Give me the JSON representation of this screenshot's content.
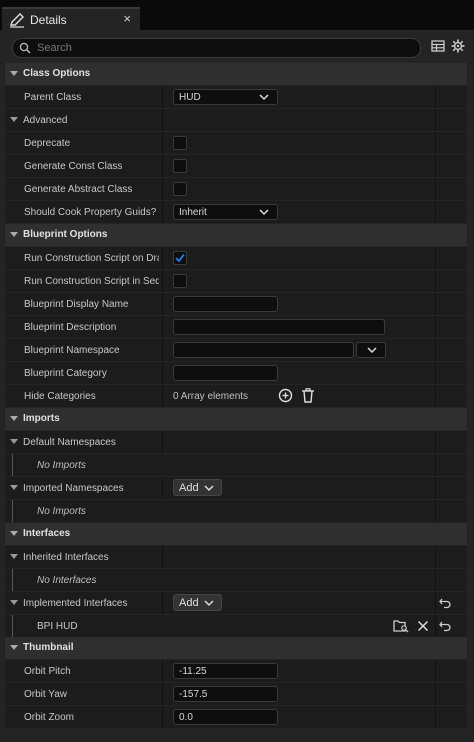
{
  "tab": {
    "title": "Details",
    "close": "×"
  },
  "search": {
    "placeholder": "Search"
  },
  "categories": {
    "class_options": "Class Options",
    "advanced": "Advanced",
    "blueprint_options": "Blueprint Options",
    "imports": "Imports",
    "interfaces": "Interfaces",
    "thumbnail": "Thumbnail"
  },
  "props": {
    "parent_class": {
      "label": "Parent Class",
      "value": "HUD"
    },
    "deprecate": {
      "label": "Deprecate",
      "checked": false
    },
    "gen_const": {
      "label": "Generate Const Class",
      "checked": false
    },
    "gen_abstract": {
      "label": "Generate Abstract Class",
      "checked": false
    },
    "cook_guids": {
      "label": "Should Cook Property Guids?",
      "value": "Inherit"
    },
    "run_cs_drag": {
      "label": "Run Construction Script on Drag",
      "checked": true
    },
    "run_cs_seq": {
      "label": "Run Construction Script in Sequ...",
      "checked": false
    },
    "bp_display_name": {
      "label": "Blueprint Display Name",
      "value": ""
    },
    "bp_description": {
      "label": "Blueprint Description",
      "value": ""
    },
    "bp_namespace": {
      "label": "Blueprint Namespace",
      "value": ""
    },
    "bp_category": {
      "label": "Blueprint Category",
      "value": ""
    },
    "hide_categories": {
      "label": "Hide Categories",
      "value": "0 Array elements"
    },
    "default_namespaces": {
      "label": "Default Namespaces",
      "empty": "No Imports"
    },
    "imported_namespaces": {
      "label": "Imported Namespaces",
      "add": "Add",
      "empty": "No Imports"
    },
    "inherited_interfaces": {
      "label": "Inherited Interfaces",
      "empty": "No Interfaces"
    },
    "implemented_interfaces": {
      "label": "Implemented Interfaces",
      "add": "Add",
      "item": "BPI HUD"
    },
    "orbit_pitch": {
      "label": "Orbit Pitch",
      "value": "-11.25"
    },
    "orbit_yaw": {
      "label": "Orbit Yaw",
      "value": "-157.5"
    },
    "orbit_zoom": {
      "label": "Orbit Zoom",
      "value": "0.0"
    }
  },
  "colors": {
    "accent_check": "#2b7de9",
    "panel_bg": "#242424",
    "row_bg": "#1c1c1c",
    "category_bg": "#2f2f2f"
  }
}
